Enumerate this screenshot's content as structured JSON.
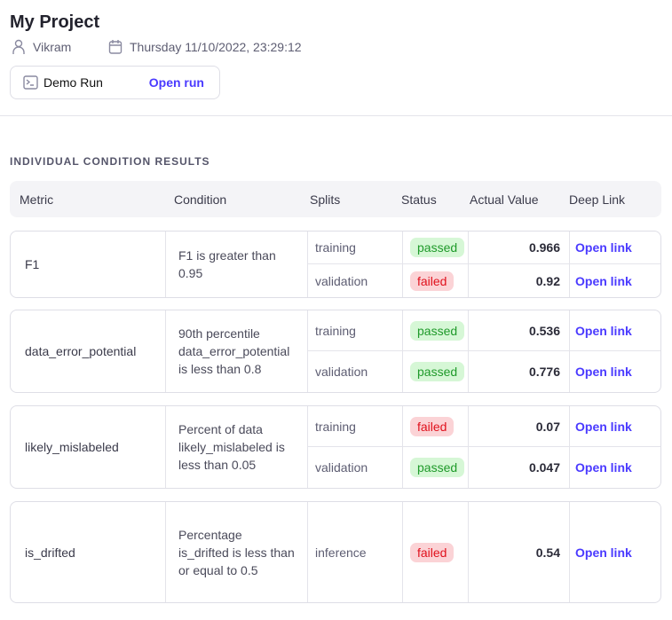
{
  "project": {
    "title": "My Project",
    "user": "Vikram",
    "date": "Thursday 11/10/2022, 23:29:12"
  },
  "run": {
    "name": "Demo Run",
    "open_label": "Open run"
  },
  "section_title": "INDIVIDUAL CONDITION RESULTS",
  "columns": [
    "Metric",
    "Condition",
    "Splits",
    "Status",
    "Actual Value",
    "Deep Link"
  ],
  "results": [
    {
      "metric": "F1",
      "condition": "F1 is greater than 0.95",
      "rows": [
        {
          "split": "training",
          "status": "passed",
          "value": "0.966",
          "link": "Open link"
        },
        {
          "split": "validation",
          "status": "failed",
          "value": "0.92",
          "link": "Open link"
        }
      ]
    },
    {
      "metric": "data_error_potential",
      "condition": "90th percentile data_error_potential is less than 0.8",
      "rows": [
        {
          "split": "training",
          "status": "passed",
          "value": "0.536",
          "link": "Open link"
        },
        {
          "split": "validation",
          "status": "passed",
          "value": "0.776",
          "link": "Open link"
        }
      ]
    },
    {
      "metric": "likely_mislabeled",
      "condition": "Percent of data likely_mislabeled is less than 0.05",
      "rows": [
        {
          "split": "training",
          "status": "failed",
          "value": "0.07",
          "link": "Open link"
        },
        {
          "split": "validation",
          "status": "passed",
          "value": "0.047",
          "link": "Open link"
        }
      ]
    },
    {
      "metric": "is_drifted",
      "condition": "Percentage is_drifted is less than or equal to 0.5",
      "rows": [
        {
          "split": "inference",
          "status": "failed",
          "value": "0.54",
          "link": "Open link"
        }
      ]
    }
  ]
}
